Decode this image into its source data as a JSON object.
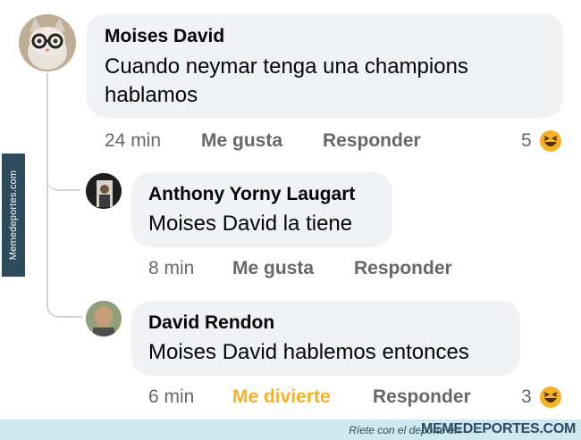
{
  "watermark": {
    "side_text": "Memedeportes.com",
    "slogan": "Ríete con el deporte en",
    "brand": "MEMEDEPORTES.COM"
  },
  "comments": [
    {
      "author": "Moises David",
      "text": "Cuando neymar tenga una champions hablamos",
      "time": "24 min",
      "like_label": "Me gusta",
      "reply_label": "Responder",
      "reaction_count": "5",
      "reaction_icon": "laughing-emoji-icon"
    },
    {
      "author": "Anthony Yorny Laugart",
      "text": "Moises David la tiene",
      "time": "8 min",
      "like_label": "Me gusta",
      "reply_label": "Responder"
    },
    {
      "author": "David Rendon",
      "text": "Moises David hablemos entonces",
      "time": "6 min",
      "like_label": "Me divierte",
      "like_color": "#f7b125",
      "reply_label": "Responder",
      "reaction_count": "3",
      "reaction_icon": "laughing-emoji-icon"
    }
  ]
}
